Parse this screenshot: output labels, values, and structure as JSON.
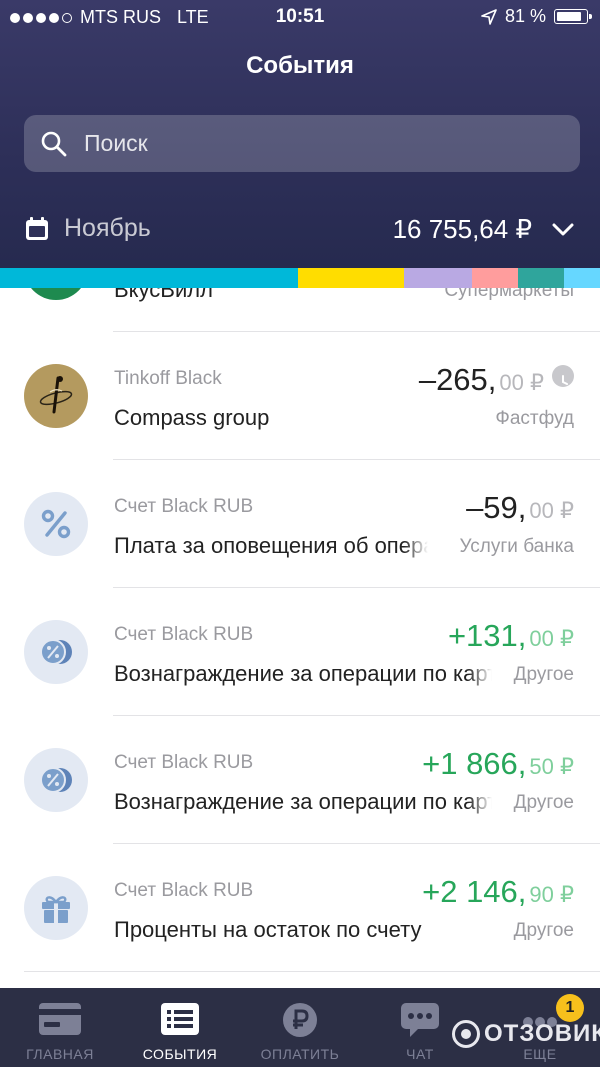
{
  "status_bar": {
    "carrier": "MTS RUS",
    "network": "LTE",
    "time": "10:51",
    "battery": "81 %"
  },
  "header": {
    "title": "События",
    "search_placeholder": "Поиск",
    "month": "Ноябрь",
    "total": "16 755,64 ₽"
  },
  "category_bar_colors": [
    "#00b8d9",
    "#ffdd00",
    "#b9a9e3",
    "#ff9d9d",
    "#2fa59c",
    "#66d7ff"
  ],
  "events": [
    {
      "account": "",
      "name": "ВкусВилл",
      "amount_int": "",
      "amount_dec": "",
      "category": "Супермаркеты",
      "positive": false
    },
    {
      "account": "Tinkoff Black",
      "name": "Compass group",
      "amount_int": "–265,",
      "amount_dec": "00 ₽",
      "category": "Фастфуд",
      "positive": false,
      "pending": true
    },
    {
      "account": "Счет Black RUB",
      "name": "Плата за оповещения об операциях",
      "amount_int": "–59,",
      "amount_dec": "00 ₽",
      "category": "Услуги банка",
      "positive": false
    },
    {
      "account": "Счет Black RUB",
      "name": "Вознаграждение за операции по карте",
      "amount_int": "+131,",
      "amount_dec": "00 ₽",
      "category": "Другое",
      "positive": true
    },
    {
      "account": "Счет Black RUB",
      "name": "Вознаграждение за операции по карте",
      "amount_int": "+1 866,",
      "amount_dec": "50 ₽",
      "category": "Другое",
      "positive": true
    },
    {
      "account": "Счет Black RUB",
      "name": "Проценты на остаток по счету",
      "amount_int": "+2 146,",
      "amount_dec": "90 ₽",
      "category": "Другое",
      "positive": true
    }
  ],
  "tabbar": {
    "items": [
      {
        "label": "ГЛАВНАЯ",
        "icon": "card-icon"
      },
      {
        "label": "СОБЫТИЯ",
        "icon": "list-icon",
        "active": true
      },
      {
        "label": "ОПЛАТИТЬ",
        "icon": "ruble-icon"
      },
      {
        "label": "ЧАТ",
        "icon": "chat-icon"
      },
      {
        "label": "ЕЩЕ",
        "icon": "more-icon"
      }
    ],
    "badge": "1"
  },
  "watermark": "ОТЗОВИК"
}
